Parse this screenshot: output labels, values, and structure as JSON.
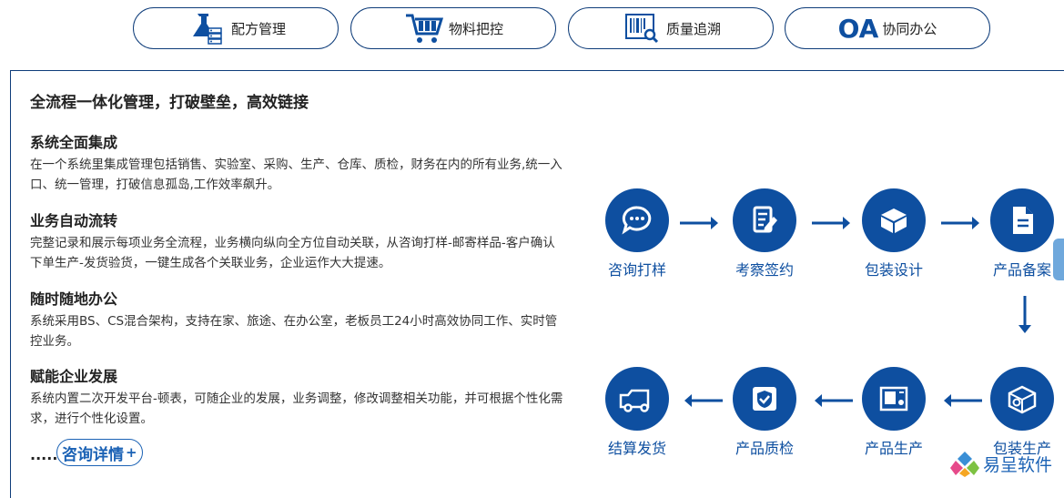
{
  "tabs": [
    {
      "label": "配方管理",
      "icon": "flask-server-icon"
    },
    {
      "label": "物料把控",
      "icon": "cart-icon"
    },
    {
      "label": "质量追溯",
      "icon": "barcode-search-icon"
    },
    {
      "label": "协同办公",
      "icon": "oa-logo-icon",
      "icon_text": "OA"
    }
  ],
  "content": {
    "headline": "全流程一体化管理，打破壁垒，高效链接",
    "sections": [
      {
        "title": "系统全面集成",
        "body": "在一个系统里集成管理包括销售、实验室、采购、生产、仓库、质检，财务在内的所有业务,统一入口、统一管理，打破信息孤岛,工作效率飙升。"
      },
      {
        "title": "业务自动流转",
        "body": "完整记录和展示每项业务全流程，业务横向纵向全方位自动关联，从咨询打样-邮寄样品-客户确认下单生产-发货验货，一键生成各个关联业务，企业运作大大提速。"
      },
      {
        "title": "随时随地办公",
        "body": "系统采用BS、CS混合架构，支持在家、旅途、在办公室，老板员工24小时高效协同工作、实时管控业务。"
      },
      {
        "title": "赋能企业发展",
        "body": "系统内置二次开发平台-顿表，可随企业的发展，业务调整，修改调整相关功能，并可根据个性化需求，进行个性化设置。"
      }
    ],
    "dots": ".....",
    "more_label": "咨询详情",
    "more_plus": "+"
  },
  "flow": {
    "top": [
      {
        "label": "咨询打样",
        "icon": "chat-bubble-icon"
      },
      {
        "label": "考察签约",
        "icon": "document-pen-icon"
      },
      {
        "label": "包装设计",
        "icon": "box-design-icon"
      },
      {
        "label": "产品备案",
        "icon": "file-icon"
      }
    ],
    "bottom": [
      {
        "label": "结算发货",
        "icon": "truck-icon"
      },
      {
        "label": "产品质检",
        "icon": "shield-check-icon"
      },
      {
        "label": "产品生产",
        "icon": "machine-icon"
      },
      {
        "label": "包装生产",
        "icon": "box-gear-icon"
      }
    ],
    "color": "#0e4fa0"
  },
  "brand": {
    "name": "易呈软件"
  },
  "colors": {
    "border": "#0f3d7a",
    "accent": "#1b62b5",
    "side_tab": "#6fa8dc"
  }
}
